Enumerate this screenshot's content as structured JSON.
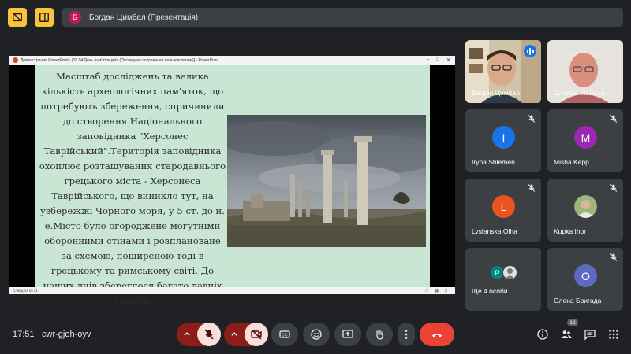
{
  "presenter": {
    "avatar_letter": "Б",
    "avatar_color": "#c2185b",
    "label": "Богдан Цимбал (Презентація)"
  },
  "top_icons": [
    "hide-self-icon",
    "layout-icon"
  ],
  "powerpoint": {
    "title": "Демонстрация PowerPoint - [18.04 День пам'яток.pptx (Последнее сохранение пользователем)] - PowerPoint",
    "status": "Слайд 14 из 21",
    "slide_text": "Масштаб досліджень та велика кількість археологічних пам'яток, що потребують збереження, спричинили до створення Національного заповідника \"Херсонес Таврійський\".Територія заповідника охоплює розташування стародавнього грецького міста - Херсонеса Таврійського, що виникло тут, на узбережжі Чорного моря, у 5 ст. до н. е.Місто було огороджене могутніми оборонними стінами і розплановане за схемою, поширеною тоді в грецькому та римському світі. До наших днів збереглося багато давніх споруд.",
    "slide_bg": "#c8e6d3"
  },
  "participants": [
    {
      "name": "Богдан Цимбал",
      "type": "video",
      "speaking": true
    },
    {
      "name": "Олексій Ільїнськ...",
      "type": "video",
      "muted": true
    },
    {
      "name": "Iryna Shlemen",
      "letter": "I",
      "color": "#1a73e8",
      "muted": true
    },
    {
      "name": "Misha Kepp",
      "letter": "M",
      "color": "#9c27b0",
      "muted": true
    },
    {
      "name": "Lysianska Olha",
      "letter": "L",
      "color": "#e8531f",
      "muted": true
    },
    {
      "name": "Kupka Ihor",
      "type": "photo",
      "muted": true
    },
    {
      "name": "Ще 4 особи",
      "type": "more",
      "mini": [
        "P",
        "photo"
      ]
    },
    {
      "name": "Олена Бригада",
      "letter": "О",
      "color": "#5c6bc0",
      "muted": true
    }
  ],
  "bottom_bar": {
    "time": "17:51",
    "meeting_code": "cwr-gjoh-oyv",
    "people_count": "12"
  }
}
